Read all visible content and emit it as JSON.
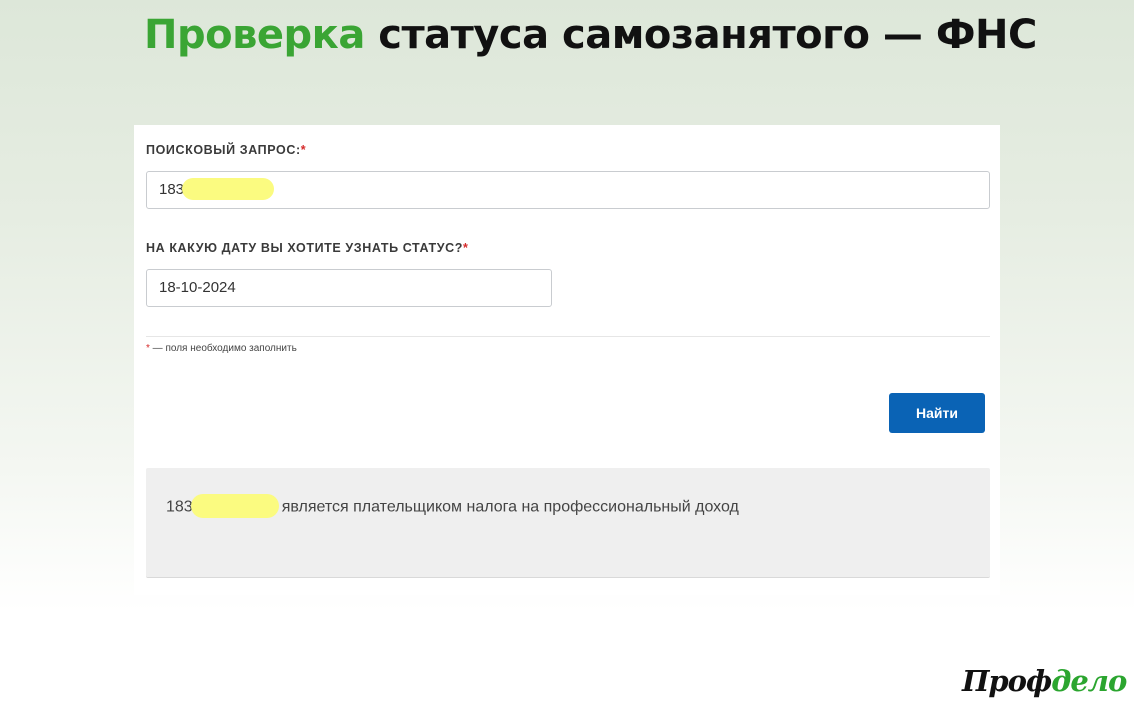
{
  "page": {
    "title_accent": "Проверка",
    "title_rest": " статуса самозанятого — ФНС"
  },
  "form": {
    "query_label": "ПОИСКОВЫЙ ЗАПРОС:",
    "query_value": "183",
    "date_label": "НА КАКУЮ ДАТУ ВЫ ХОТИТЕ УЗНАТЬ СТАТУС?",
    "date_value": "18-10-2024",
    "required_mark": "*",
    "required_note": " — поля необходимо заполнить",
    "submit_label": "Найти"
  },
  "result": {
    "inn_prefix": "183",
    "message": "является плательщиком налога на профессиональный доход"
  },
  "logo": {
    "part1": "Проф",
    "part2": "дело"
  },
  "colors": {
    "accent_green": "#3aa534",
    "button_blue": "#0a63b5",
    "required_red": "#d62b2b",
    "redaction_yellow": "#fbfb80"
  }
}
